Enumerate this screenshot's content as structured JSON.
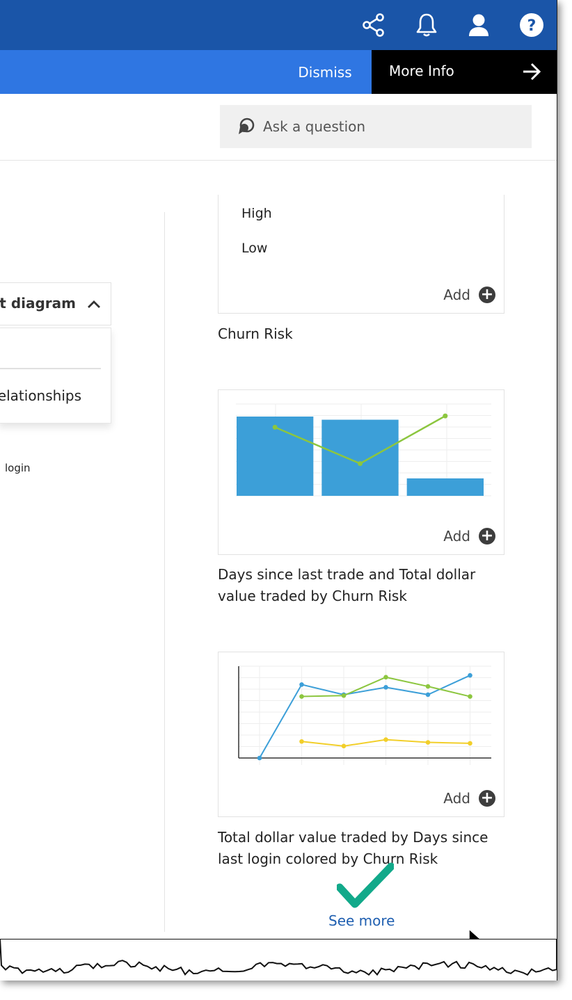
{
  "header": {
    "icons": [
      "share-icon",
      "bell-icon",
      "user-icon",
      "help-icon"
    ],
    "help_glyph": "?"
  },
  "notification": {
    "dismiss_label": "Dismiss",
    "more_info_label": "More Info"
  },
  "search": {
    "placeholder": "Ask a question"
  },
  "left_panel": {
    "dropdown_title": "it diagram",
    "menu_item": "elationships",
    "partial_text": "login"
  },
  "cards": [
    {
      "options": [
        "High",
        "Low"
      ],
      "add_label": "Add",
      "caption": "Churn Risk"
    },
    {
      "add_label": "Add",
      "caption": "Days since last trade and Total dollar value traded by Churn Risk"
    },
    {
      "add_label": "Add",
      "caption": "Total dollar value traded by Days since last login colored by Churn Risk"
    }
  ],
  "see_more_label": "See more",
  "colors": {
    "topbar": "#1a55a8",
    "notice": "#2f76e2",
    "bar_blue": "#3c9fd8",
    "line_green": "#8cc63f",
    "line_yellow": "#f2cf2a",
    "check_teal": "#12a98a"
  },
  "chart_data": [
    {
      "type": "bar",
      "categories": [
        "",
        "",
        ""
      ],
      "series": [
        {
          "values": [
            1.0,
            0.96,
            0.22
          ]
        },
        {
          "values": [
            0.85,
            0.4,
            0.99
          ]
        }
      ]
    },
    {
      "type": "line",
      "x": [
        1,
        2,
        3,
        4,
        5,
        6
      ],
      "series": [
        {
          "values": [
            0,
            0.8,
            0.69,
            0.77,
            0.69,
            0.9
          ]
        },
        {
          "values": [
            null,
            0.67,
            0.68,
            0.88,
            0.78,
            0.67
          ]
        },
        {
          "values": [
            null,
            0.18,
            0.13,
            0.2,
            0.17,
            0.16
          ]
        }
      ]
    }
  ]
}
